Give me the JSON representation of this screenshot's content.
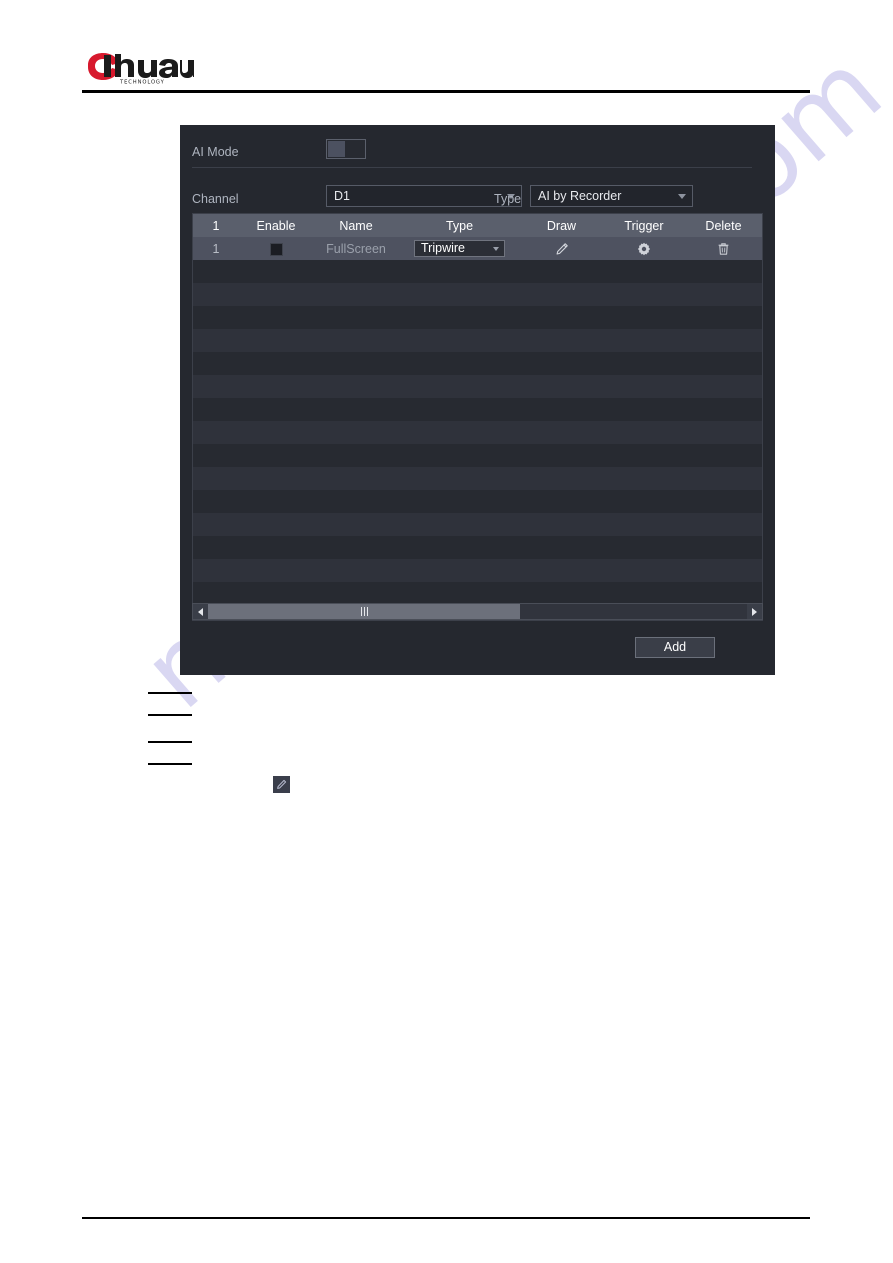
{
  "document": {
    "brand_name": "alhua",
    "brand_tagline": "TECHNOLOGY",
    "watermark": "manualshive.com"
  },
  "panel": {
    "ai_mode": {
      "label": "AI Mode",
      "toggle_state": "off",
      "toggle_name": "ai-mode-toggle"
    },
    "channel": {
      "label": "Channel",
      "value": "D1",
      "caret": "chevron-down-icon"
    },
    "type": {
      "label": "Type",
      "value": "AI by Recorder",
      "caret": "chevron-down-icon"
    },
    "table": {
      "columns": [
        {
          "key": "index",
          "label": "1"
        },
        {
          "key": "enable",
          "label": "Enable"
        },
        {
          "key": "name",
          "label": "Name"
        },
        {
          "key": "type",
          "label": "Type"
        },
        {
          "key": "draw",
          "label": "Draw"
        },
        {
          "key": "trigger",
          "label": "Trigger"
        },
        {
          "key": "delete",
          "label": "Delete"
        }
      ],
      "rows": [
        {
          "index": "1",
          "enable_checked": false,
          "name": "FullScreen",
          "type": "Tripwire",
          "draw_icon": "pencil-icon",
          "trigger_icon": "gear-icon",
          "delete_icon": "trash-icon",
          "selected": true
        }
      ],
      "empty_row_count": 15
    },
    "scrollbar": {
      "left_arrow": "arrow-left-icon",
      "right_arrow": "arrow-right-icon",
      "orientation": "horizontal"
    },
    "add_button": {
      "label": "Add"
    }
  },
  "body_notes": {
    "inline_icon": "pencil-icon",
    "redacted_line_count": 4
  },
  "colors": {
    "panel_bg": "#25282f",
    "table_header_bg": "#5a5f6c",
    "row_odd": "#272a31",
    "row_even": "#2f323b",
    "row_selected": "#4e5260",
    "text_primary": "#ffffff",
    "text_secondary": "#aeb4bf",
    "brand_red": "#d7192d",
    "watermark_color": "#d9d7f2"
  }
}
